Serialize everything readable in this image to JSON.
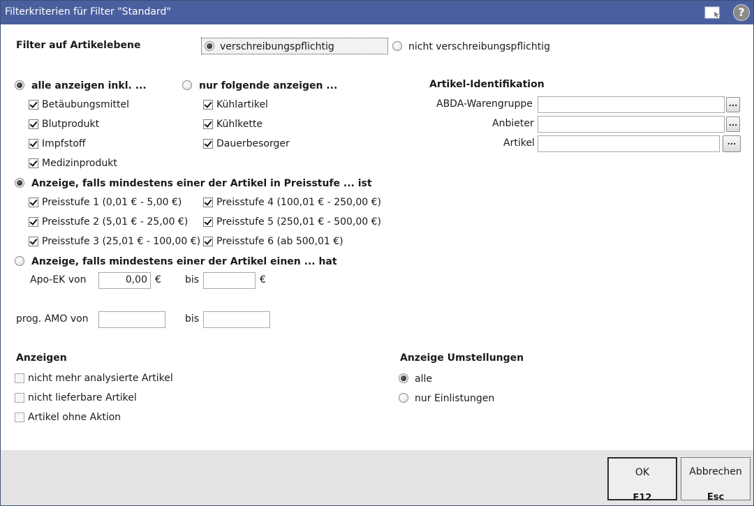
{
  "window": {
    "title": "Filterkriterien für Filter \"Standard\"",
    "help_label": "?"
  },
  "artikelebene": {
    "label": "Filter auf Artikelebene",
    "option_rx": "verschreibungspflichtig",
    "option_nonrx": "nicht verschreibungspflichtig",
    "selected": "verschreibungspflichtig"
  },
  "show_all": {
    "label": "alle anzeigen inkl. ...",
    "items": [
      {
        "label": "Betäubungsmittel",
        "checked": true
      },
      {
        "label": "Blutprodukt",
        "checked": true
      },
      {
        "label": "Impfstoff",
        "checked": true
      },
      {
        "label": "Medizinprodukt",
        "checked": true
      }
    ]
  },
  "show_only": {
    "label": "nur folgende anzeigen ...",
    "items": [
      {
        "label": "Kühlartikel",
        "checked": true
      },
      {
        "label": "Kühlkette",
        "checked": true
      },
      {
        "label": "Dauerbesorger",
        "checked": true
      }
    ]
  },
  "identifikation": {
    "title": "Artikel-Identifikation",
    "fields": [
      {
        "label": "ABDA-Warengruppe",
        "value": "",
        "button": "..."
      },
      {
        "label": "Anbieter",
        "value": "",
        "button": "..."
      },
      {
        "label": "Artikel",
        "value": "",
        "button": "..."
      }
    ]
  },
  "preisstufe": {
    "label": "Anzeige, falls mindestens einer der Artikel in Preisstufe ... ist",
    "items": [
      {
        "label": "Preisstufe 1 (0,01 € - 5,00 €)",
        "checked": true
      },
      {
        "label": "Preisstufe 2 (5,01 € - 25,00 €)",
        "checked": true
      },
      {
        "label": "Preisstufe 3 (25,01 € - 100,00 €)",
        "checked": true
      },
      {
        "label": "Preisstufe 4 (100,01 € - 250,00 €)",
        "checked": true
      },
      {
        "label": "Preisstufe 5 (250,01 € - 500,00 €)",
        "checked": true
      },
      {
        "label": "Preisstufe 6 (ab 500,01 €)",
        "checked": true
      }
    ]
  },
  "range": {
    "label": "Anzeige, falls mindestens einer der Artikel einen ... hat",
    "apo_ek_label": "Apo-EK von",
    "apo_ek_from": "0,00",
    "apo_ek_to": "",
    "currency": "€",
    "bis_label": "bis",
    "amo_label": "prog. AMO von",
    "amo_from": "",
    "amo_to": ""
  },
  "anzeigen": {
    "title": "Anzeigen",
    "items": [
      {
        "label": "nicht mehr analysierte Artikel",
        "checked": false
      },
      {
        "label": "nicht lieferbare Artikel",
        "checked": false
      },
      {
        "label": "Artikel ohne Aktion",
        "checked": false
      }
    ]
  },
  "umstellungen": {
    "title": "Anzeige Umstellungen",
    "option_all": "alle",
    "option_listing": "nur Einlistungen",
    "selected": "alle"
  },
  "footer": {
    "ok_label": "OK",
    "ok_key": "F12",
    "cancel_label": "Abbrechen",
    "cancel_key": "Esc"
  }
}
